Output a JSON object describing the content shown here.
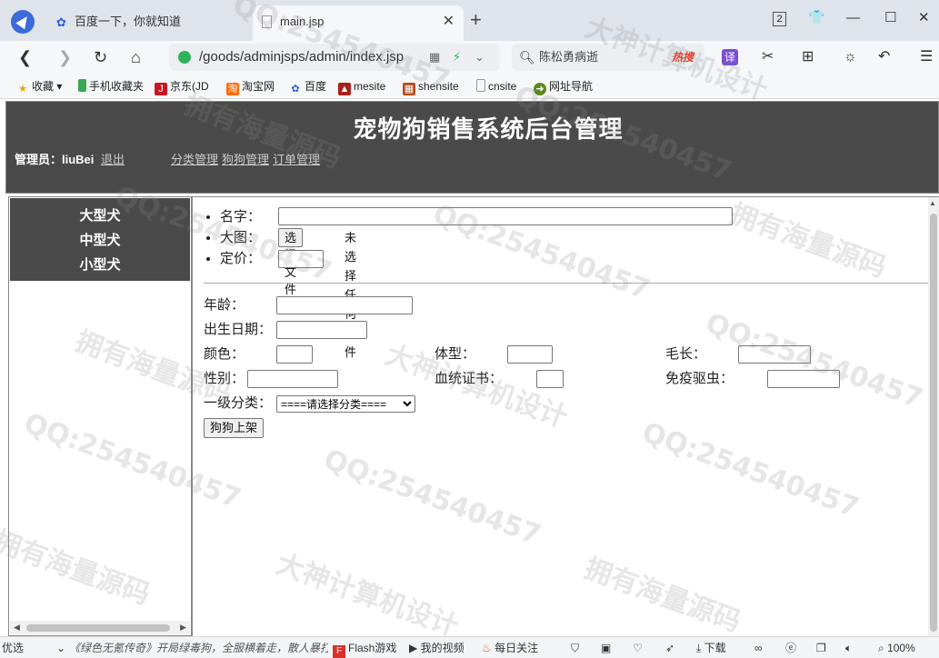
{
  "browser": {
    "tabs": [
      {
        "title": "百度一下，你就知道",
        "active": false
      },
      {
        "title": "main.jsp",
        "active": true
      }
    ],
    "window_counter": "2",
    "address": "/goods/adminjsps/admin/index.jsp",
    "search": {
      "value": "陈松勇病逝",
      "badge": "热搜"
    },
    "translate_label": "译",
    "bookmarks": [
      {
        "label": "收藏"
      },
      {
        "label": "手机收藏夹"
      },
      {
        "label": "京东(JD"
      },
      {
        "label": "淘宝网"
      },
      {
        "label": "百度"
      },
      {
        "label": "mesite"
      },
      {
        "label": "shensite"
      },
      {
        "label": "cnsite"
      },
      {
        "label": "网址导航"
      }
    ],
    "icons": {
      "back": "back-icon",
      "forward": "forward-icon",
      "reload": "reload-icon",
      "home": "home-icon"
    }
  },
  "header": {
    "title": "宠物狗销售系统后台管理",
    "admin_label": "管理员：liuBei",
    "logout": "退出",
    "menu": [
      "分类管理",
      "狗狗管理",
      "订单管理"
    ]
  },
  "sidebar": {
    "categories": [
      "大型犬",
      "中型犬",
      "小型犬"
    ]
  },
  "form": {
    "name_label": "名字：",
    "image_label": "大图：",
    "file_button": "选择文件",
    "file_status": "未选择任何文件",
    "price_label": "定价：",
    "age_label": "年龄：",
    "birth_label": "出生日期：",
    "color_label": "颜色：",
    "size_label": "体型：",
    "hair_label": "毛长：",
    "gender_label": "性别：",
    "pedigree_label": "血统证书：",
    "vaccine_label": "免疫驱虫：",
    "category_label": "一级分类：",
    "category_placeholder": "====请选择分类====",
    "submit": "狗狗上架"
  },
  "statusbar": {
    "left": "优选",
    "news": "《绿色无氪传奇》开局绿毒狗，全服横着走，散人暴打",
    "items": [
      "Flash游戏",
      "我的视频",
      "每日关注",
      "下载",
      "100%"
    ]
  },
  "watermark": {
    "qq": "QQ:254540457",
    "brand1": "拥有海量源码",
    "brand2": "大神计算机设计"
  }
}
